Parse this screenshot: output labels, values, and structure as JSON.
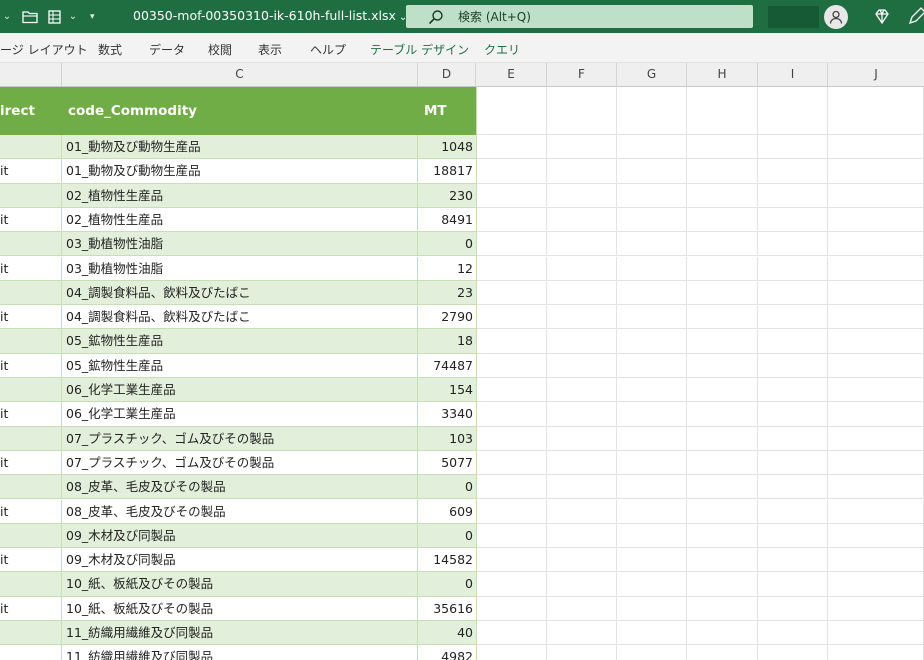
{
  "titlebar": {
    "filename": "00350-mof-00350310-ik-610h-full-list.xlsx",
    "dropdown_glyph": "⌄",
    "search_placeholder": "検索 (Alt+Q)",
    "bg_color": "#1e6e42"
  },
  "ribbon": {
    "tabs": [
      "ージ レイアウト",
      "数式",
      "データ",
      "校閲",
      "表示",
      "ヘルプ",
      "テーブル デザイン",
      "クエリ"
    ]
  },
  "columns": [
    "C",
    "D",
    "E",
    "F",
    "G",
    "H",
    "I",
    "J"
  ],
  "table": {
    "headers": {
      "a": "irect",
      "c": "code_Commodity",
      "d": "MT"
    },
    "header_color": "#70ad47",
    "band_color": "#e2efda",
    "rows": [
      {
        "a": "",
        "c": "01_動物及び動物生産品",
        "d": "1048"
      },
      {
        "a": "it",
        "c": "01_動物及び動物生産品",
        "d": "18817"
      },
      {
        "a": "",
        "c": "02_植物性生産品",
        "d": "230"
      },
      {
        "a": "it",
        "c": "02_植物性生産品",
        "d": "8491"
      },
      {
        "a": "",
        "c": "03_動植物性油脂",
        "d": "0"
      },
      {
        "a": "it",
        "c": "03_動植物性油脂",
        "d": "12"
      },
      {
        "a": "",
        "c": "04_調製食料品、飲料及びたばこ",
        "d": "23"
      },
      {
        "a": "it",
        "c": "04_調製食料品、飲料及びたばこ",
        "d": "2790"
      },
      {
        "a": "",
        "c": "05_鉱物性生産品",
        "d": "18"
      },
      {
        "a": "it",
        "c": "05_鉱物性生産品",
        "d": "74487"
      },
      {
        "a": "",
        "c": "06_化学工業生産品",
        "d": "154"
      },
      {
        "a": "it",
        "c": "06_化学工業生産品",
        "d": "3340"
      },
      {
        "a": "",
        "c": "07_プラスチック、ゴム及びその製品",
        "d": "103"
      },
      {
        "a": "it",
        "c": "07_プラスチック、ゴム及びその製品",
        "d": "5077"
      },
      {
        "a": "",
        "c": "08_皮革、毛皮及びその製品",
        "d": "0"
      },
      {
        "a": "it",
        "c": "08_皮革、毛皮及びその製品",
        "d": "609"
      },
      {
        "a": "",
        "c": "09_木材及び同製品",
        "d": "0"
      },
      {
        "a": "it",
        "c": "09_木材及び同製品",
        "d": "14582"
      },
      {
        "a": "",
        "c": "10_紙、板紙及びその製品",
        "d": "0"
      },
      {
        "a": "it",
        "c": "10_紙、板紙及びその製品",
        "d": "35616"
      },
      {
        "a": "",
        "c": "11_紡織用繊維及び同製品",
        "d": "40"
      },
      {
        "a": "",
        "c": "11_紡織用繊維及び同製品",
        "d": "4982"
      }
    ]
  }
}
